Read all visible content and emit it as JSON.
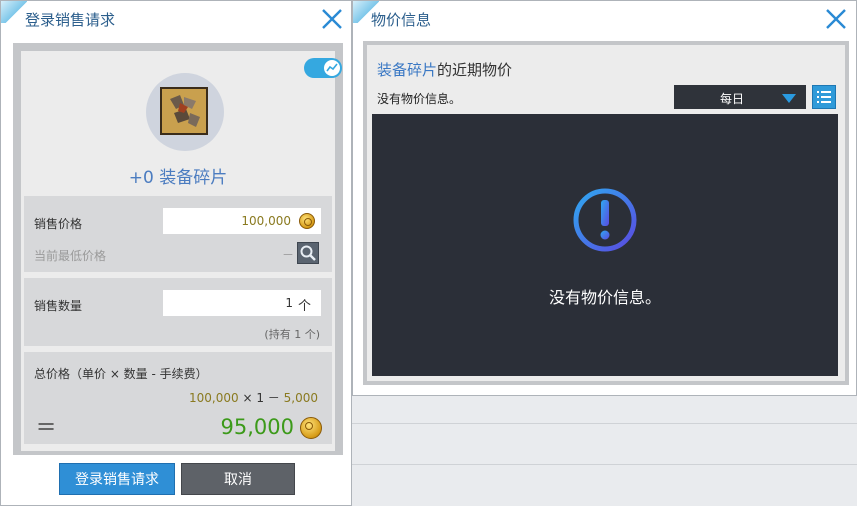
{
  "sell_window": {
    "title": "登录销售请求",
    "item_name": "+0  装备碎片",
    "price": {
      "label": "销售价格",
      "value": "100,000",
      "lowest_label": "当前最低价格",
      "lowest_value": "－"
    },
    "quantity": {
      "label": "销售数量",
      "value": "1",
      "unit": "个",
      "owned": "(持有 1 个)"
    },
    "total": {
      "label": "总价格（单价 × 数量 - 手续费）",
      "unit_price": "100,000",
      "times": "×",
      "qty": "1",
      "minus": "－",
      "fee": "5,000",
      "equals": "=",
      "result": "95,000"
    },
    "submit_label": "登录销售请求",
    "cancel_label": "取消"
  },
  "price_window": {
    "title": "物价信息",
    "heading_item": "装备碎片",
    "heading_rest": "的近期物价",
    "no_info_small": "没有物价信息。",
    "period_selected": "每日",
    "no_info_big": "没有物价信息。"
  },
  "colors": {
    "accent_blue": "#2f8fd6",
    "item_name_blue": "#4b7cc0",
    "price_gold": "#8a7a20",
    "total_green": "#3c9a1a",
    "chart_bg": "#2b2f38"
  },
  "icons": [
    "close-icon",
    "toggle-chart-icon",
    "item-icon",
    "coin-icon",
    "search-icon",
    "list-icon",
    "alert-icon",
    "dropdown-arrow-icon"
  ]
}
